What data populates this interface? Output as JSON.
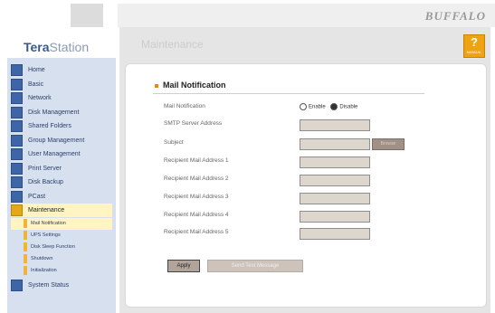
{
  "brand": "BUFFALO",
  "logo": {
    "tera": "Tera",
    "station": "Station"
  },
  "page_title": "Maintenance",
  "help": {
    "symbol": "?",
    "label": "MANUAL"
  },
  "sidebar": {
    "items": [
      {
        "label": "Home"
      },
      {
        "label": "Basic"
      },
      {
        "label": "Network"
      },
      {
        "label": "Disk Management"
      },
      {
        "label": "Shared Folders"
      },
      {
        "label": "Group Management"
      },
      {
        "label": "User Management"
      },
      {
        "label": "Print Server"
      },
      {
        "label": "Disk Backup"
      },
      {
        "label": "PCast"
      },
      {
        "label": "Maintenance"
      }
    ],
    "subitems": [
      {
        "label": "Mail Notification"
      },
      {
        "label": "UPS Settings"
      },
      {
        "label": "Disk Sleep Function"
      },
      {
        "label": "Shutdown"
      },
      {
        "label": "Initialization"
      }
    ],
    "last": {
      "label": "System Status"
    }
  },
  "section": {
    "title": "Mail Notification",
    "mail_notification_label": "Mail Notification",
    "enable_label": "Enable",
    "disable_label": "Disable",
    "smtp_label": "SMTP Server Address",
    "subject_label": "Subject",
    "browse_label": "Browse",
    "recipient_labels": [
      "Recipient Mail Address 1",
      "Recipient Mail Address 2",
      "Recipient Mail Address 3",
      "Recipient Mail Address 4",
      "Recipient Mail Address 5"
    ]
  },
  "buttons": {
    "apply": "Apply",
    "send_test": "Send Test Message"
  }
}
